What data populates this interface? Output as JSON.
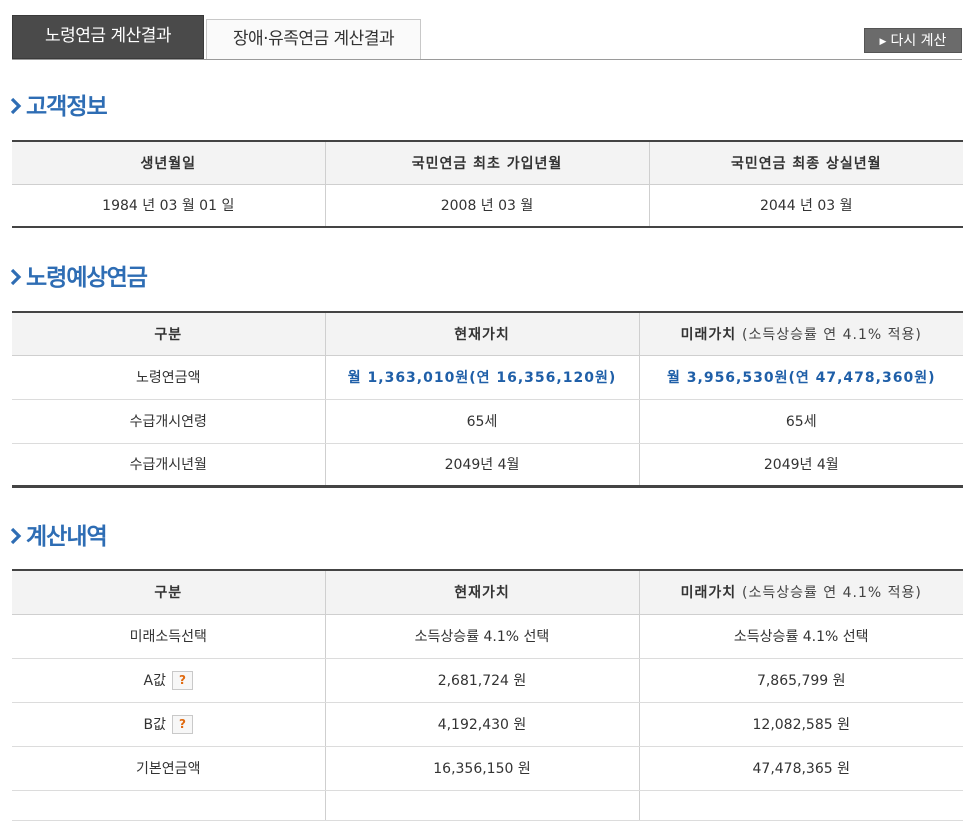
{
  "tabs": {
    "old_age": "노령연금 계산결과",
    "disability": "장애·유족연금 계산결과"
  },
  "recalc_label": "다시 계산",
  "customer": {
    "title": "고객정보",
    "headers": [
      "생년월일",
      "국민연금 최초 가입년월",
      "국민연금 최종 상실년월"
    ],
    "values": [
      "1984 년 03 월 01 일",
      "2008 년 03 월",
      "2044 년 03 월"
    ]
  },
  "pension": {
    "title": "노령예상연금",
    "headers": [
      "구분",
      "현재가치",
      "미래가치"
    ],
    "future_note": "(소득상승률 연 4.1% 적용)",
    "rows": [
      {
        "label": "노령연금액",
        "current": "월 1,363,010원(연 16,356,120원)",
        "future": "월 3,956,530원(연 47,478,360원)"
      },
      {
        "label": "수급개시연령",
        "current": "65세",
        "future": "65세"
      },
      {
        "label": "수급개시년월",
        "current": "2049년 4월",
        "future": "2049년 4월"
      }
    ]
  },
  "calc": {
    "title": "계산내역",
    "headers": [
      "구분",
      "현재가치",
      "미래가치"
    ],
    "future_note": "(소득상승률 연 4.1% 적용)",
    "help_glyph": "?",
    "rows": [
      {
        "label": "미래소득선택",
        "current": "소득상승률 4.1% 선택",
        "future": "소득상승률 4.1% 선택"
      },
      {
        "label": "A값",
        "current": "2,681,724 원",
        "future": "7,865,799 원"
      },
      {
        "label": "B값",
        "current": "4,192,430 원",
        "future": "12,082,585 원"
      },
      {
        "label": "기본연금액",
        "current": "16,356,150 원",
        "future": "47,478,365 원"
      }
    ]
  },
  "colors": {
    "accent_blue": "#2e6db4",
    "value_blue": "#1f5fa8",
    "active_tab": "#4a4a4a",
    "help_orange": "#e06a10"
  }
}
